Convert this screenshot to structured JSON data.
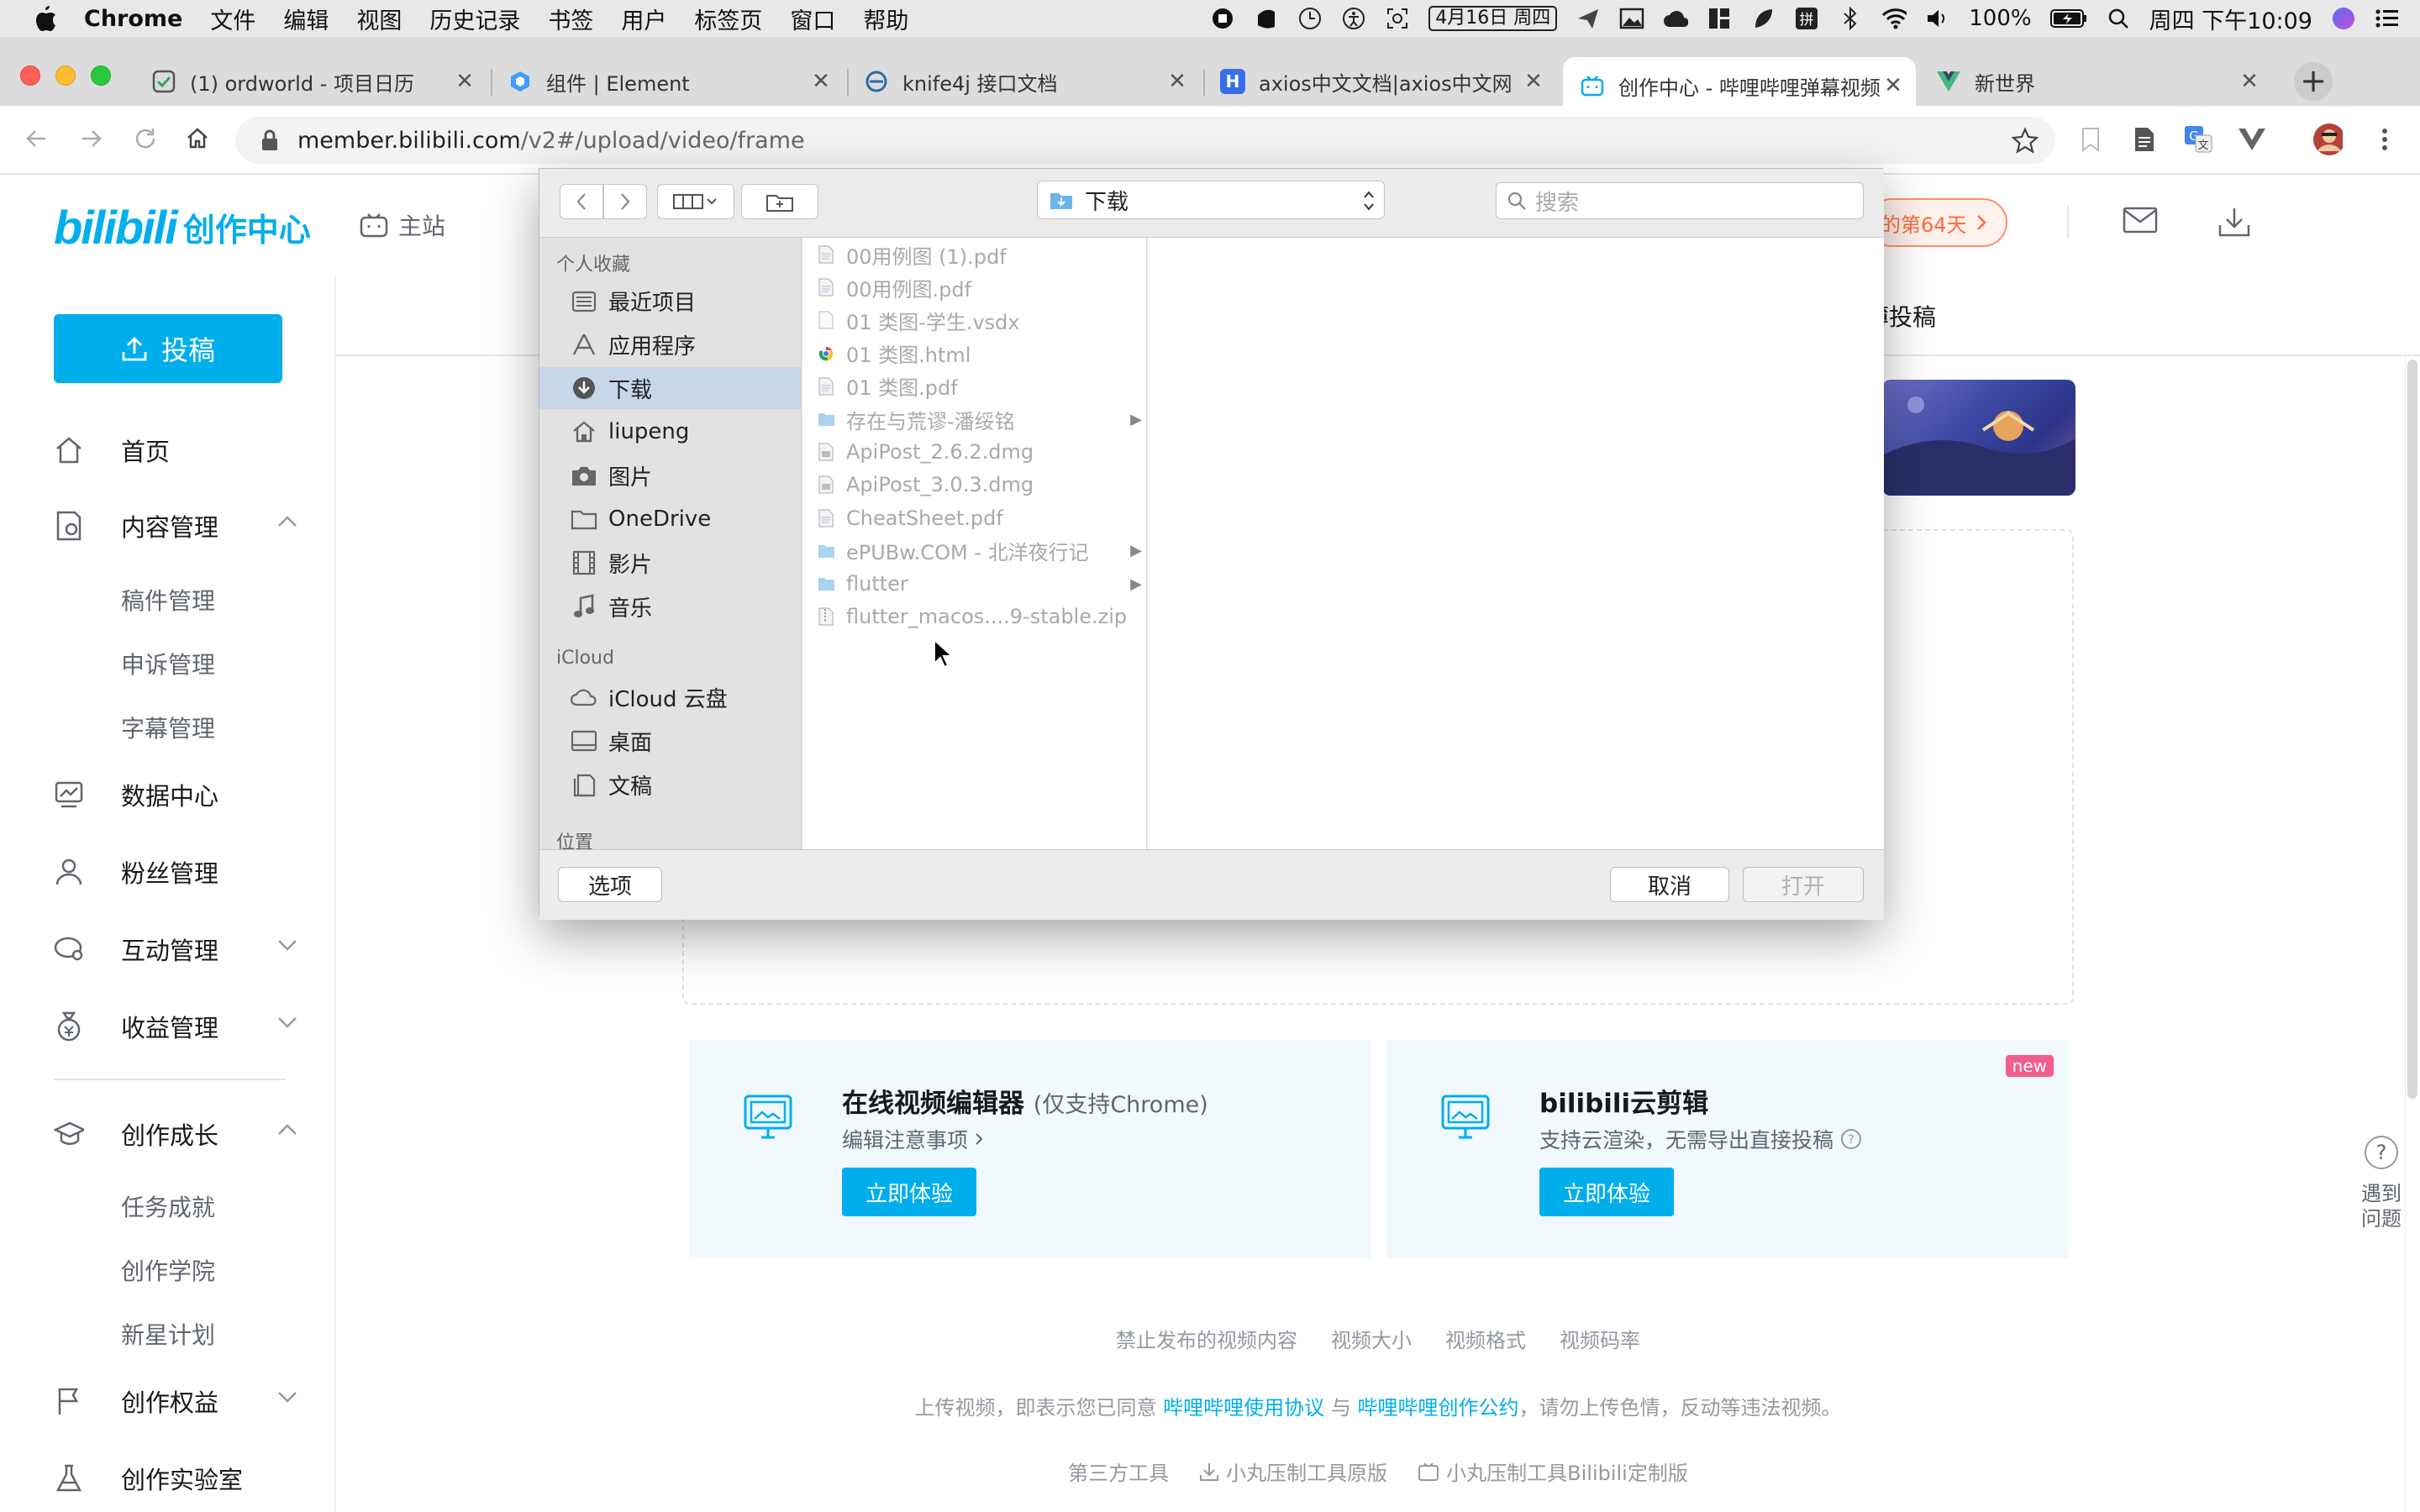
{
  "menubar": {
    "app": "Chrome",
    "items": [
      "文件",
      "编辑",
      "视图",
      "历史记录",
      "书签",
      "用户",
      "标签页",
      "窗口",
      "帮助"
    ],
    "date_badge": "4月16日 周四",
    "battery": "100%",
    "clock": "周四 下午10:09"
  },
  "tabs": [
    {
      "title": "(1) ordworld - 项目日历",
      "icon": "checkbox-icon",
      "color": "#555555"
    },
    {
      "title": "组件 | Element",
      "icon": "element-icon",
      "color": "#409eff"
    },
    {
      "title": "knife4j 接口文档",
      "icon": "knife4j-icon",
      "color": "#2b6aa8"
    },
    {
      "title": "axios中文文档|axios中文网",
      "icon": "axios-icon",
      "color": "#3a6ee8"
    },
    {
      "title": "创作中心 - 哔哩哔哩弹幕视频网",
      "icon": "bilibili-tv-icon",
      "color": "#00aeec"
    },
    {
      "title": "新世界",
      "icon": "vue-icon",
      "color": "#41b883"
    }
  ],
  "url": {
    "host": "member.bilibili.com",
    "path": "/v2#/upload/video/frame"
  },
  "header": {
    "logo_mark": "bilibili",
    "logo_text": "创作中心",
    "home_link": "主站",
    "promo": "的第64天"
  },
  "sidebar": {
    "upload_label": "投稿",
    "items": [
      {
        "label": "首页"
      },
      {
        "label": "内容管理"
      },
      {
        "label": "稿件管理"
      },
      {
        "label": "申诉管理"
      },
      {
        "label": "字幕管理"
      },
      {
        "label": "数据中心"
      },
      {
        "label": "粉丝管理"
      },
      {
        "label": "互动管理"
      },
      {
        "label": "收益管理"
      },
      {
        "label": "创作成长"
      },
      {
        "label": "任务成就"
      },
      {
        "label": "创作学院"
      },
      {
        "label": "新星计划"
      },
      {
        "label": "创作权益"
      },
      {
        "label": "创作实验室"
      }
    ]
  },
  "main": {
    "draft_tab": "薄投稿",
    "editor_card": {
      "title": "在线视频编辑器",
      "note": "(仅支持Chrome)",
      "desc": "编辑注意事项",
      "button": "立即体验"
    },
    "cloud_card": {
      "title": "bilibili云剪辑",
      "desc": "支持云渲染，无需导出直接投稿",
      "button": "立即体验",
      "badge": "new"
    },
    "footer_links": [
      "禁止发布的视频内容",
      "视频大小",
      "视频格式",
      "视频码率"
    ],
    "agreement": {
      "prefix": "上传视频，即表示您已同意",
      "link1": "哔哩哔哩使用协议",
      "mid": "与",
      "link2": "哔哩哔哩创作公约",
      "suffix": "，请勿上传色情，反动等违法视频。"
    },
    "tools": [
      "第三方工具",
      "小丸压制工具原版",
      "小丸压制工具Bilibili定制版"
    ],
    "help": [
      "遇到",
      "问题"
    ]
  },
  "dialog": {
    "location": "下载",
    "search_placeholder": "搜索",
    "favorites_header": "个人收藏",
    "favorites": [
      "最近项目",
      "应用程序",
      "下载",
      "liupeng",
      "图片",
      "OneDrive",
      "影片",
      "音乐"
    ],
    "icloud_header": "iCloud",
    "icloud": [
      "iCloud 云盘",
      "桌面",
      "文稿"
    ],
    "locations_header": "位置",
    "files": [
      {
        "name": "00用例图 (1).pdf",
        "kind": "pdf"
      },
      {
        "name": "00用例图.pdf",
        "kind": "pdf"
      },
      {
        "name": "01 类图-学生.vsdx",
        "kind": "doc"
      },
      {
        "name": "01 类图.html",
        "kind": "html"
      },
      {
        "name": "01 类图.pdf",
        "kind": "pdf"
      },
      {
        "name": "存在与荒谬-潘绥铭",
        "kind": "folder"
      },
      {
        "name": "ApiPost_2.6.2.dmg",
        "kind": "dmg"
      },
      {
        "name": "ApiPost_3.0.3.dmg",
        "kind": "dmg"
      },
      {
        "name": "CheatSheet.pdf",
        "kind": "pdf"
      },
      {
        "name": "ePUBw.COM - 北洋夜行记",
        "kind": "folder"
      },
      {
        "name": "flutter",
        "kind": "folder"
      },
      {
        "name": "flutter_macos....9-stable.zip",
        "kind": "zip"
      }
    ],
    "options_button": "选项",
    "cancel_button": "取消",
    "open_button": "打开"
  }
}
